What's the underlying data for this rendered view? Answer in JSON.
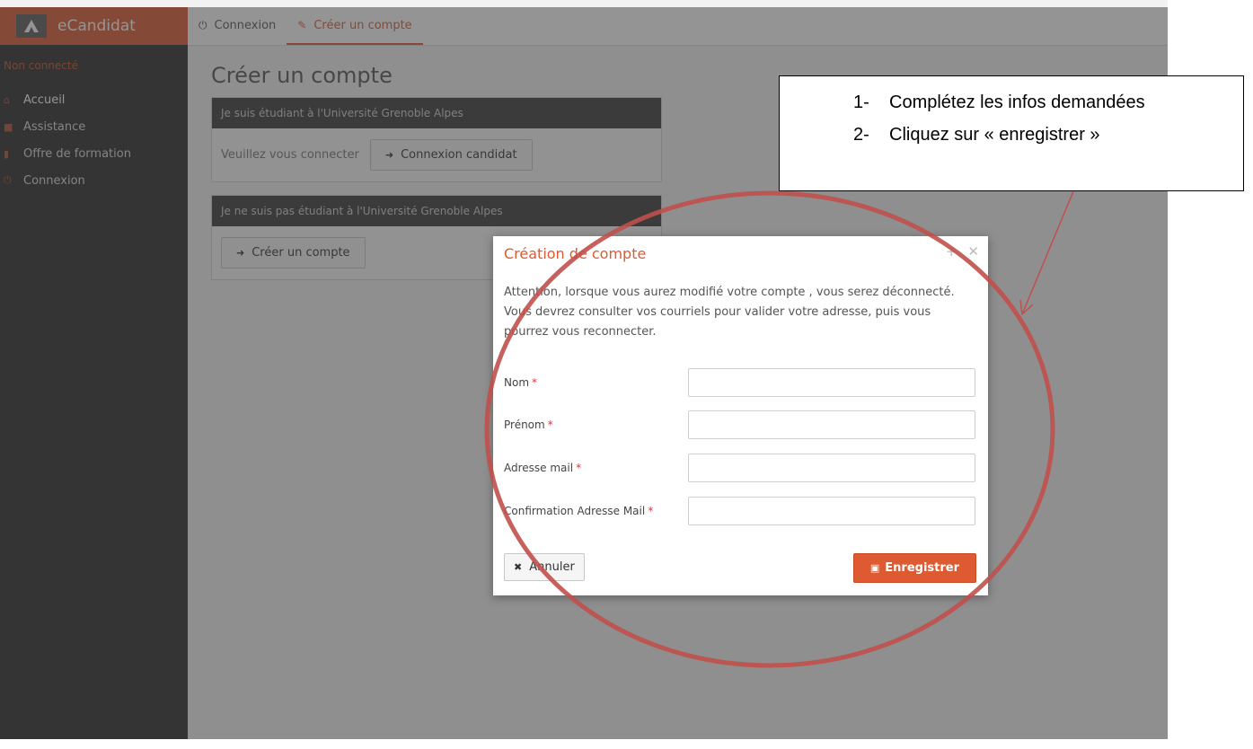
{
  "sidebar": {
    "brand": "eCandidat",
    "status": "Non connecté",
    "items": [
      {
        "label": "Accueil",
        "icon": "home-icon"
      },
      {
        "label": "Assistance",
        "icon": "help-icon"
      },
      {
        "label": "Offre de formation",
        "icon": "bookmark-icon"
      },
      {
        "label": "Connexion",
        "icon": "power-icon"
      }
    ]
  },
  "topbar": {
    "tabs": [
      {
        "label": "Connexion",
        "icon": "power-icon"
      },
      {
        "label": "Créer un compte",
        "icon": "pencil-icon"
      }
    ]
  },
  "main": {
    "title": "Créer un compte",
    "panel_uga": {
      "heading": "Je suis étudiant à l'Université Grenoble Alpes",
      "text": "Veuillez vous connecter",
      "button": "Connexion candidat"
    },
    "panel_other": {
      "heading": "Je ne suis pas étudiant à l'Université Grenoble Alpes",
      "button": "Créer un compte"
    }
  },
  "modal": {
    "title": "Création de compte",
    "message": "Attention, lorsque vous aurez modifié votre compte , vous serez déconnecté. Vous devrez consulter vos courriels pour valider votre adresse, puis vous pourrez vous reconnecter.",
    "fields": [
      {
        "label": "Nom",
        "value": ""
      },
      {
        "label": "Prénom",
        "value": ""
      },
      {
        "label": "Adresse mail",
        "value": ""
      },
      {
        "label": "Confirmation Adresse Mail",
        "value": ""
      }
    ],
    "required_mark": "*",
    "cancel": "Annuler",
    "save": "Enregistrer"
  },
  "callout": {
    "steps": [
      {
        "num": "1-",
        "text": "Complétez les infos demandées"
      },
      {
        "num": "2-",
        "text": "Cliquez sur « enregistrer »"
      }
    ]
  },
  "colors": {
    "accent": "#de5a32",
    "annotation": "#c0504d",
    "sidebar": "#2b2b2b"
  }
}
